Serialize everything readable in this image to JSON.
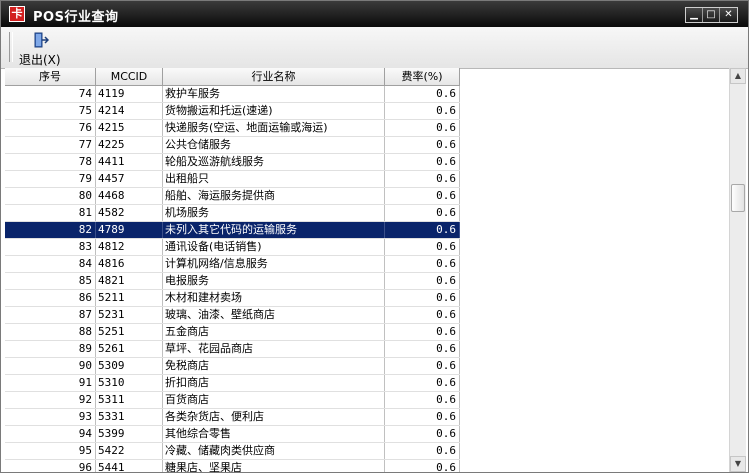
{
  "window": {
    "title": "POS行业查询",
    "icon_glyph": "卡"
  },
  "window_controls": {
    "minimize": "▁",
    "maximize": "□",
    "close": "✕"
  },
  "toolbar": {
    "exit_label": "退出(X)"
  },
  "table": {
    "columns": [
      "序号",
      "MCCID",
      "行业名称",
      "费率(%)"
    ],
    "selected_index": 8,
    "rows": [
      [
        "74",
        "4119",
        "救护车服务",
        "0.6"
      ],
      [
        "75",
        "4214",
        "货物搬运和托运(速递)",
        "0.6"
      ],
      [
        "76",
        "4215",
        "快递服务(空运、地面运输或海运)",
        "0.6"
      ],
      [
        "77",
        "4225",
        "公共仓储服务",
        "0.6"
      ],
      [
        "78",
        "4411",
        "轮船及巡游航线服务",
        "0.6"
      ],
      [
        "79",
        "4457",
        "出租船只",
        "0.6"
      ],
      [
        "80",
        "4468",
        "船舶、海运服务提供商",
        "0.6"
      ],
      [
        "81",
        "4582",
        "机场服务",
        "0.6"
      ],
      [
        "82",
        "4789",
        "未列入其它代码的运输服务",
        "0.6"
      ],
      [
        "83",
        "4812",
        "通讯设备(电话销售)",
        "0.6"
      ],
      [
        "84",
        "4816",
        "计算机网络/信息服务",
        "0.6"
      ],
      [
        "85",
        "4821",
        "电报服务",
        "0.6"
      ],
      [
        "86",
        "5211",
        "木材和建材卖场",
        "0.6"
      ],
      [
        "87",
        "5231",
        "玻璃、油漆、壁纸商店",
        "0.6"
      ],
      [
        "88",
        "5251",
        "五金商店",
        "0.6"
      ],
      [
        "89",
        "5261",
        "草坪、花园品商店",
        "0.6"
      ],
      [
        "90",
        "5309",
        "免税商店",
        "0.6"
      ],
      [
        "91",
        "5310",
        "折扣商店",
        "0.6"
      ],
      [
        "92",
        "5311",
        "百货商店",
        "0.6"
      ],
      [
        "93",
        "5331",
        "各类杂货店、便利店",
        "0.6"
      ],
      [
        "94",
        "5399",
        "其他综合零售",
        "0.6"
      ],
      [
        "95",
        "5422",
        "冷藏、储藏肉类供应商",
        "0.6"
      ],
      [
        "96",
        "5441",
        "糖果店、坚果店",
        "0.6"
      ]
    ]
  },
  "scrollbar": {
    "up": "▲",
    "down": "▼"
  }
}
